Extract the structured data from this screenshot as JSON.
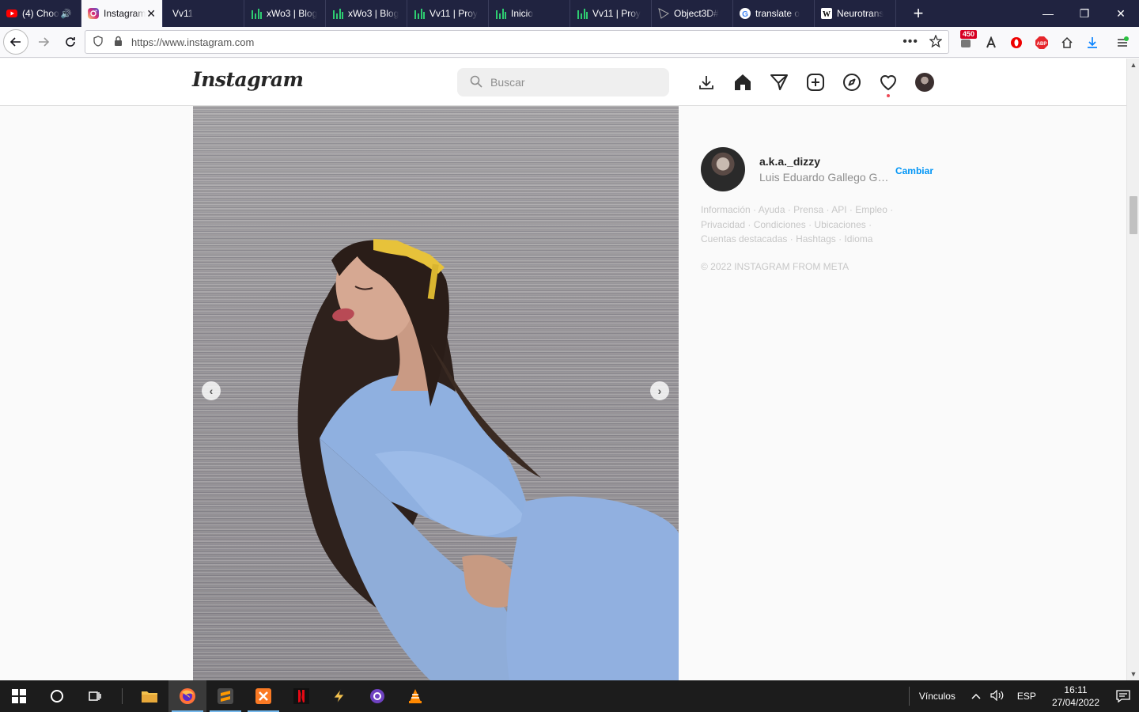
{
  "browser": {
    "tabs": [
      {
        "label": "(4) Choo",
        "icon": "youtube-icon"
      },
      {
        "label": "Instagram",
        "icon": "instagram-icon",
        "active": true
      },
      {
        "label": "Vv11",
        "icon": ""
      },
      {
        "label": "xWo3 | Blog",
        "icon": "chart-icon"
      },
      {
        "label": "xWo3 | Blog",
        "icon": "chart-icon"
      },
      {
        "label": "Vv11 | Proy",
        "icon": "chart-icon"
      },
      {
        "label": "Inicio",
        "icon": "chart-icon"
      },
      {
        "label": "Vv11 | Proy",
        "icon": "chart-icon"
      },
      {
        "label": "Object3D#",
        "icon": "threejs-icon"
      },
      {
        "label": "translate o",
        "icon": "google-icon"
      },
      {
        "label": "Neurotrans",
        "icon": "wikipedia-icon"
      }
    ],
    "url": "https://www.instagram.com",
    "extension_badge": "450"
  },
  "instagram": {
    "logo": "Instagram",
    "search_placeholder": "Buscar",
    "profile": {
      "username": "a.k.a._dizzy",
      "fullname": "Luis Eduardo Gallego Gar...",
      "switch_label": "Cambiar"
    },
    "footer_links_line1": "Información · Ayuda · Prensa · API · Empleo ·",
    "footer_links_line2": "Privacidad · Condiciones · Ubicaciones ·",
    "footer_links_line3": "Cuentas destacadas · Hashtags · Idioma",
    "copyright": "© 2022 INSTAGRAM FROM META"
  },
  "taskbar": {
    "links_label": "Vínculos",
    "language": "ESP",
    "time": "16:11",
    "date": "27/04/2022"
  },
  "colors": {
    "accent_blue": "#0095f6",
    "tab_strip": "#202340",
    "notification_dot": "#ed4956"
  }
}
